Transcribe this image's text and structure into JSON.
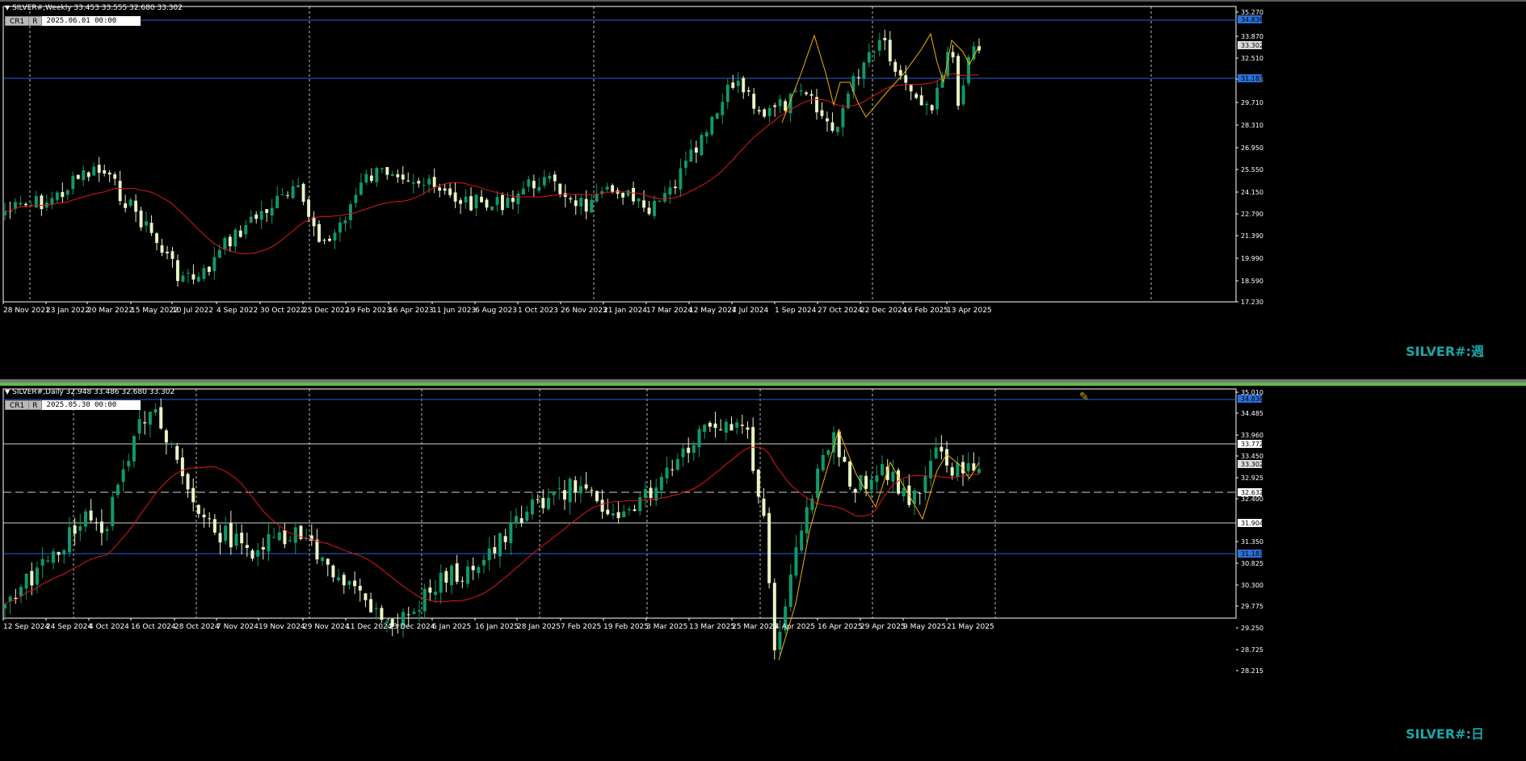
{
  "weekly": {
    "header": "SILVER#,Weekly  33.453 33.555 32.680 33.302",
    "selector_label": "CR1",
    "selector_r": "R",
    "selector_date": "2025.06.01 00:00",
    "watermark": "SILVER#:週",
    "y_ticks": [
      "35.270",
      "33.870",
      "32.510",
      "31.183",
      "29.710",
      "28.310",
      "26.950",
      "25.550",
      "24.150",
      "22.790",
      "21.390",
      "19.990",
      "18.590",
      "17.230"
    ],
    "y_price_tags": [
      "34.838",
      "33.302",
      "31.183"
    ],
    "x_ticks": [
      "28 Nov 2021",
      "23 Jan 2022",
      "20 Mar 2022",
      "15 May 2022",
      "10 Jul 2022",
      "4 Sep 2022",
      "30 Oct 2022",
      "25 Dec 2022",
      "19 Feb 2023",
      "16 Apr 2023",
      "11 Jun 2023",
      "6 Aug 2023",
      "1 Oct 2023",
      "26 Nov 2023",
      "21 Jan 2024",
      "17 Mar 2024",
      "12 May 2024",
      "7 Jul 2024",
      "1 Sep 2024",
      "27 Oct 2024",
      "22 Dec 2024",
      "16 Feb 2025",
      "13 Apr 2025"
    ]
  },
  "daily": {
    "header": "SILVER#,Daily  32.948 33.486 32.680 33.302",
    "selector_label": "CR1",
    "selector_r": "R",
    "selector_date": "2025.05.30 00:00",
    "watermark": "SILVER#:日",
    "y_ticks": [
      "35.010",
      "34.485",
      "33.960",
      "33.450",
      "32.925",
      "32.400",
      "31.350",
      "30.825",
      "30.300",
      "29.775",
      "29.250",
      "28.725",
      "28.215"
    ],
    "y_price_tags": [
      "34.838",
      "33.772",
      "33.302",
      "32.632",
      "31.904",
      "31.183"
    ],
    "x_ticks": [
      "12 Sep 2024",
      "24 Sep 2024",
      "4 Oct 2024",
      "16 Oct 2024",
      "28 Oct 2024",
      "7 Nov 2024",
      "19 Nov 2024",
      "29 Nov 2024",
      "11 Dec 2024",
      "23 Dec 2024",
      "6 Jan 2025",
      "16 Jan 2025",
      "28 Jan 2025",
      "7 Feb 2025",
      "19 Feb 2025",
      "3 Mar 2025",
      "13 Mar 2025",
      "25 Mar 2025",
      "4 Apr 2025",
      "16 Apr 2025",
      "29 Apr 2025",
      "9 May 2025",
      "21 May 2025"
    ]
  },
  "colors": {
    "bull": "#0f9a6a",
    "bear": "#e8f5c4",
    "ma": "#e0151a",
    "zigzag": "#f0b000",
    "level_blue": "#2563d8",
    "level_white": "#d0d0d0",
    "axis": "#ffffff",
    "grid": "#bbbbbb",
    "price_tag": "#2b6fd8"
  }
}
